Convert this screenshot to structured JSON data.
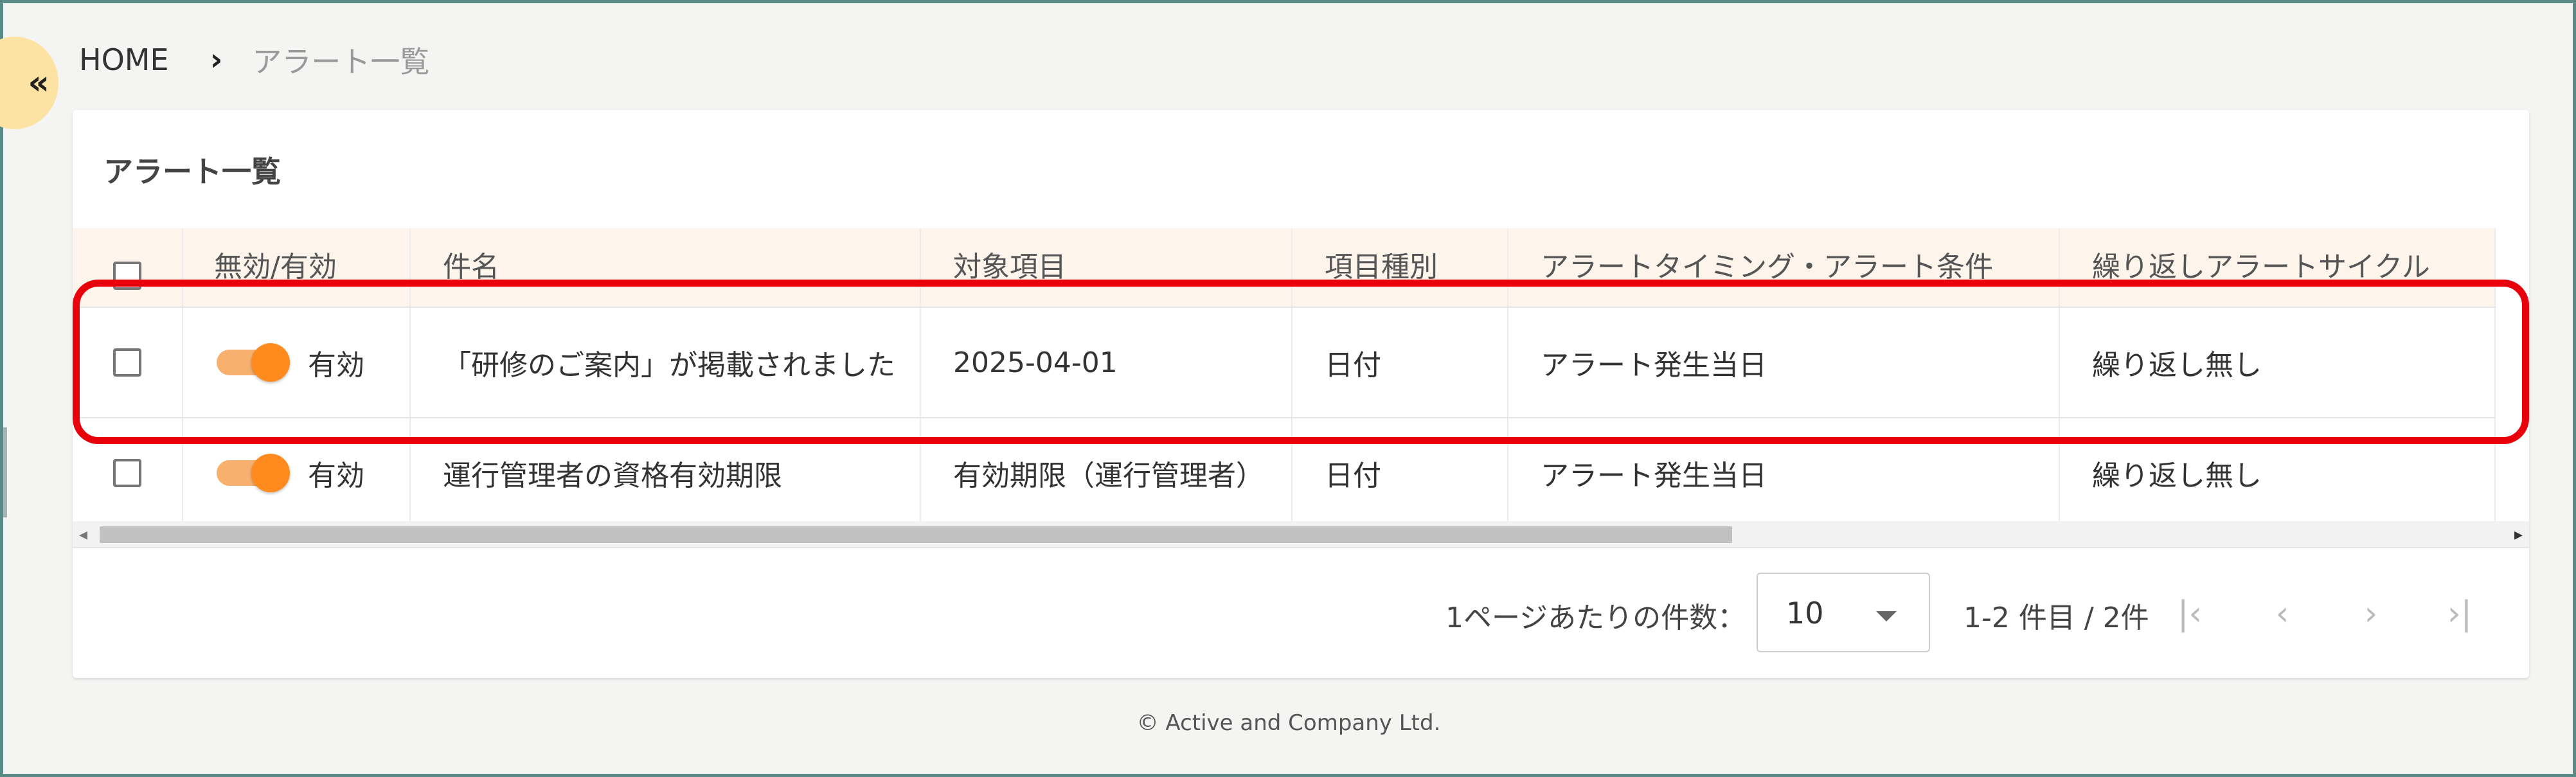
{
  "breadcrumb": {
    "home": "HOME",
    "separator": "›",
    "current": "アラート一覧"
  },
  "sidebar": {
    "collapse_icon": "«"
  },
  "card": {
    "title": "アラート一覧"
  },
  "table": {
    "headers": [
      "",
      "無効/有効",
      "件名",
      "対象項目",
      "項目種別",
      "アラートタイミング・アラート条件",
      "繰り返しアラートサイクル"
    ],
    "rows": [
      {
        "enabled": true,
        "status_label": "有効",
        "subject": "「研修のご案内」が掲載されました",
        "target": "2025-04-01",
        "type": "日付",
        "timing": "アラート発生当日",
        "cycle": "繰り返し無し"
      },
      {
        "enabled": true,
        "status_label": "有効",
        "subject": "運行管理者の資格有効期限",
        "target": "有効期限（運行管理者）",
        "type": "日付",
        "timing": "アラート発生当日",
        "cycle": "繰り返し無し"
      }
    ]
  },
  "scroll": {
    "left_arrow": "◂",
    "right_arrow": "▸"
  },
  "pagination": {
    "per_page_label": "1ページあたりの件数：",
    "per_page_value": "10",
    "range": "1-2 件目 / 2件",
    "first_icon": "|‹",
    "prev_icon": "‹",
    "next_icon": "›",
    "last_icon": "›|"
  },
  "footer": {
    "copyright": "© Active and Company Ltd."
  },
  "colors": {
    "accent": "#ff8a1d",
    "highlight": "#e8000b",
    "header_bg": "#fdf4ec"
  }
}
